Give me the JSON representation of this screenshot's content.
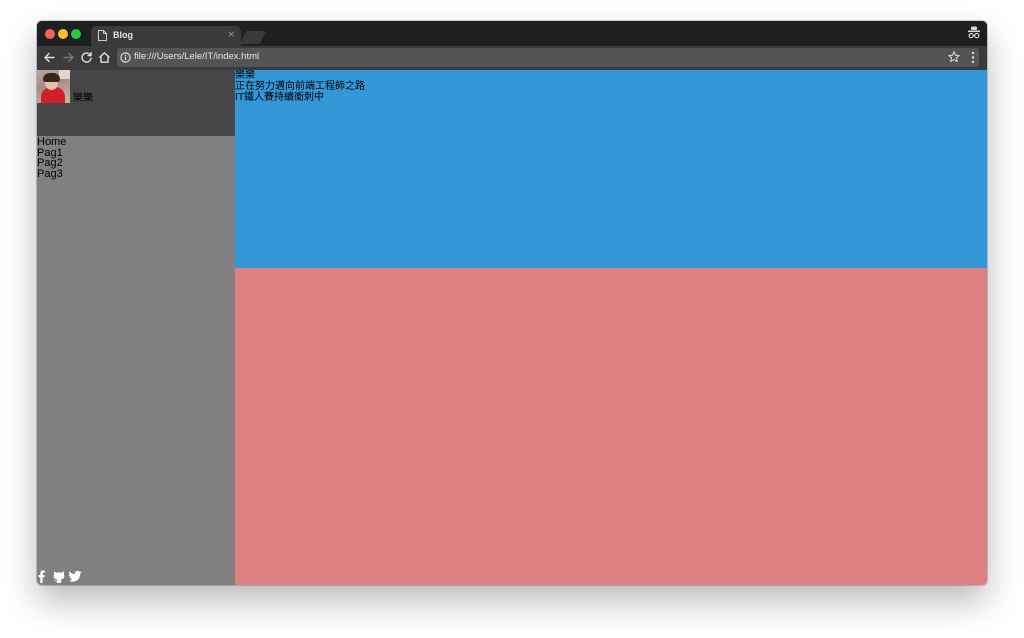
{
  "browser": {
    "tab": {
      "title": "Blog",
      "close_glyph": "×",
      "icon": "document-icon"
    },
    "toolbar": {
      "url": "file:///Users/Lele/IT/index.html",
      "icons": [
        "arrow-left-icon",
        "arrow-right-icon",
        "reload-icon",
        "home-icon",
        "info-icon",
        "star-icon",
        "menu-icon",
        "incognito-icon"
      ]
    },
    "colors": {
      "titlebar": "#1e1f21",
      "toolbar": "#3b3b3d",
      "omnibox": "#545457",
      "close": "#fe5f57",
      "minimize": "#febc2e",
      "zoom": "#28c840"
    }
  },
  "page": {
    "sidebar": {
      "profile": {
        "name": "樂樂",
        "avatar": "profile-photo"
      },
      "nav": [
        {
          "label": "Home"
        },
        {
          "label": "Pag1"
        },
        {
          "label": "Pag2"
        },
        {
          "label": "Pag3"
        }
      ],
      "social": [
        "facebook-icon",
        "github-icon",
        "twitter-icon"
      ]
    },
    "header": {
      "name": "樂樂",
      "tagline": "正在努力邁向前端工程師之路",
      "subtitle": "IT鐵人賽持續衝刺中"
    },
    "colors": {
      "sidebar": "#808080",
      "profile_panel": "#474747",
      "header": "#3498d8",
      "main": "#df8080"
    }
  }
}
